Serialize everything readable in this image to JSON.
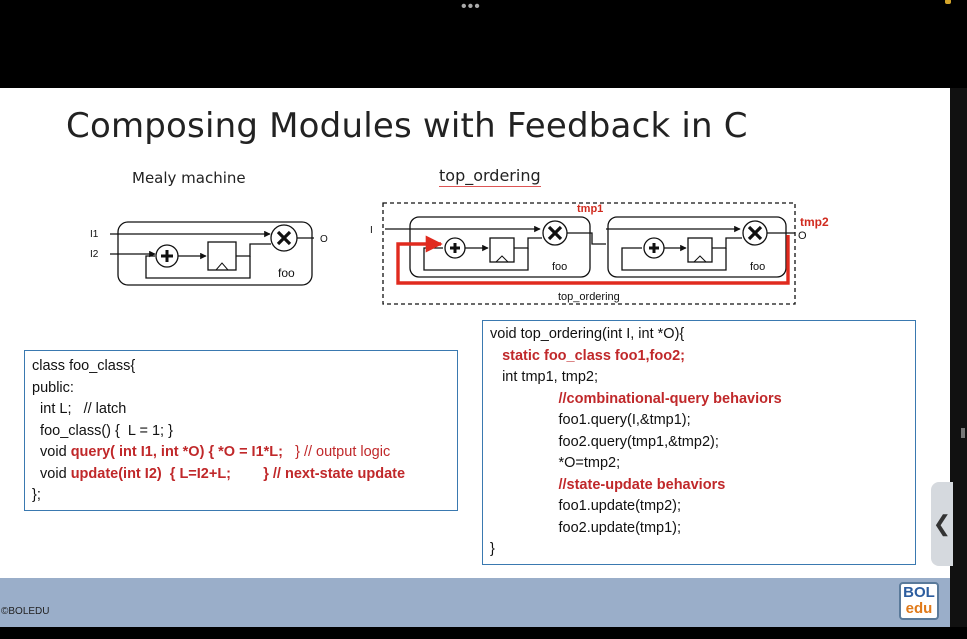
{
  "window": {
    "more_menu": "•••"
  },
  "slide": {
    "title": "Composing Modules with Feedback in C",
    "mealy_label": "Mealy machine",
    "top_label": "top_ordering",
    "diagram": {
      "mealy": {
        "in1": "I1",
        "in2": "I2",
        "out": "O",
        "module": "foo"
      },
      "top": {
        "in": "I",
        "tmp1": "tmp1",
        "tmp2": "tmp2",
        "out": "O",
        "module1": "foo",
        "module2": "foo",
        "caption": "top_ordering"
      }
    },
    "left_code": {
      "l1": "class foo_class{",
      "l2": "public:",
      "l3": "  int L;   // latch",
      "l4": "  foo_class() {  L = 1; }",
      "l5_a": "  void ",
      "l5_b": "query( int I1, int *O) { *O = I1*L;",
      "l5_c": "   } // output logic",
      "l6_a": "  void ",
      "l6_b": "update(int I2)  { L=I2+L;        } // next-state update",
      "l7": "};"
    },
    "right_code": {
      "l1": "void top_ordering(int I, int *O){",
      "l2": "   static foo_class foo1,foo2;",
      "l3": "   int tmp1, tmp2;",
      "l4": "                 //combinational-query behaviors",
      "l5": "                 foo1.query(I,&tmp1);",
      "l6": "                 foo2.query(tmp1,&tmp2);",
      "l7": "                 *O=tmp2;",
      "l8": "                 //state-update behaviors",
      "l9": "                 foo1.update(tmp2);",
      "l10": "                 foo2.update(tmp1);",
      "l11": "}"
    },
    "copyright": "©BOLEDU",
    "logo_top": "BOL",
    "logo_bottom": "edu"
  },
  "side_panel": {
    "collapse_glyph": "❮"
  },
  "colors": {
    "accent_red": "#c0282a",
    "footer_blue": "#9aaec9",
    "code_border": "#3a79b0"
  }
}
